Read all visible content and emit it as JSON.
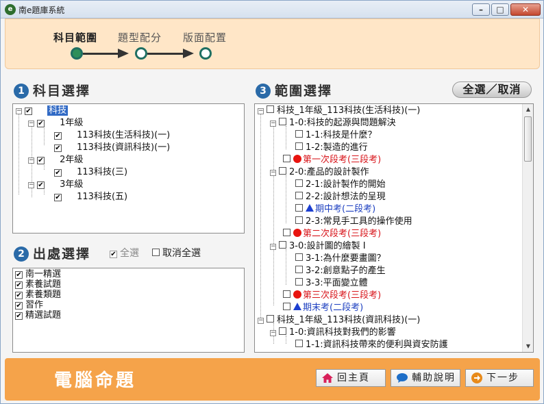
{
  "window": {
    "title": "南e題庫系統",
    "app_icon": "app-logo-icon"
  },
  "wizard": {
    "steps": [
      {
        "label": "科目範圍",
        "active": true
      },
      {
        "label": "題型配分",
        "active": false
      },
      {
        "label": "版面配置",
        "active": false
      }
    ]
  },
  "subject": {
    "number": "1",
    "title": "科目選擇",
    "tree": [
      {
        "label": "科技",
        "level": 0,
        "selected": true
      },
      {
        "label": "1年級",
        "level": 1
      },
      {
        "label": "113科技(生活科技)(一)",
        "level": 2
      },
      {
        "label": "113科技(資訊科技)(一)",
        "level": 2
      },
      {
        "label": "2年級",
        "level": 1
      },
      {
        "label": "113科技(三)",
        "level": 2
      },
      {
        "label": "3年級",
        "level": 1
      },
      {
        "label": "113科技(五)",
        "level": 2
      }
    ]
  },
  "source": {
    "number": "2",
    "title": "出處選擇",
    "select_all": "全選",
    "deselect_all": "取消全選",
    "items": [
      "南一精選",
      "素養試題",
      "素養類題",
      "習作",
      "精選試題"
    ]
  },
  "range": {
    "number": "3",
    "title": "範圍選擇",
    "toggle_all": "全選／取消",
    "tree": [
      {
        "label": "科技_1年級_113科技(生活科技)(一)",
        "level": 0,
        "type": "node"
      },
      {
        "label": "1-0:科技的起源與問題解決",
        "level": 1,
        "type": "node"
      },
      {
        "label": "1-1:科技是什麼？",
        "level": 2,
        "type": "leaf"
      },
      {
        "label": "1-2:製造的進行",
        "level": 2,
        "type": "leaf"
      },
      {
        "label": "第一次段考(三段考)",
        "level": 1,
        "type": "exam-red"
      },
      {
        "label": "2-0:產品的設計製作",
        "level": 1,
        "type": "node"
      },
      {
        "label": "2-1:設計製作的開始",
        "level": 2,
        "type": "leaf"
      },
      {
        "label": "2-2:設計想法的呈現",
        "level": 2,
        "type": "leaf"
      },
      {
        "label": "期中考(二段考)",
        "level": 2,
        "type": "exam-blue"
      },
      {
        "label": "2-3:常見手工具的操作使用",
        "level": 2,
        "type": "leaf"
      },
      {
        "label": "第二次段考(三段考)",
        "level": 1,
        "type": "exam-red"
      },
      {
        "label": "3-0:設計圖的繪製 I",
        "level": 1,
        "type": "node"
      },
      {
        "label": "3-1:為什麼要畫圖？",
        "level": 2,
        "type": "leaf"
      },
      {
        "label": "3-2:創意點子的產生",
        "level": 2,
        "type": "leaf"
      },
      {
        "label": "3-3:平面變立體",
        "level": 2,
        "type": "leaf"
      },
      {
        "label": "第三次段考(三段考)",
        "level": 1,
        "type": "exam-red"
      },
      {
        "label": "期末考(二段考)",
        "level": 1,
        "type": "exam-blue"
      },
      {
        "label": "科技_1年級_113科技(資訊科技)(一)",
        "level": 0,
        "type": "node"
      },
      {
        "label": "1-0:資訊科技對我們的影響",
        "level": 1,
        "type": "node"
      },
      {
        "label": "1-1:資訊科技帶來的便利與資安防護",
        "level": 2,
        "type": "leaf"
      }
    ]
  },
  "footer": {
    "title": "電腦命題",
    "home": "回主頁",
    "help": "輔助說明",
    "next": "下一步"
  },
  "colors": {
    "accent": "#f5a34a",
    "wizard_bg": "#ffe6c7",
    "badge": "#2a6aa8"
  }
}
